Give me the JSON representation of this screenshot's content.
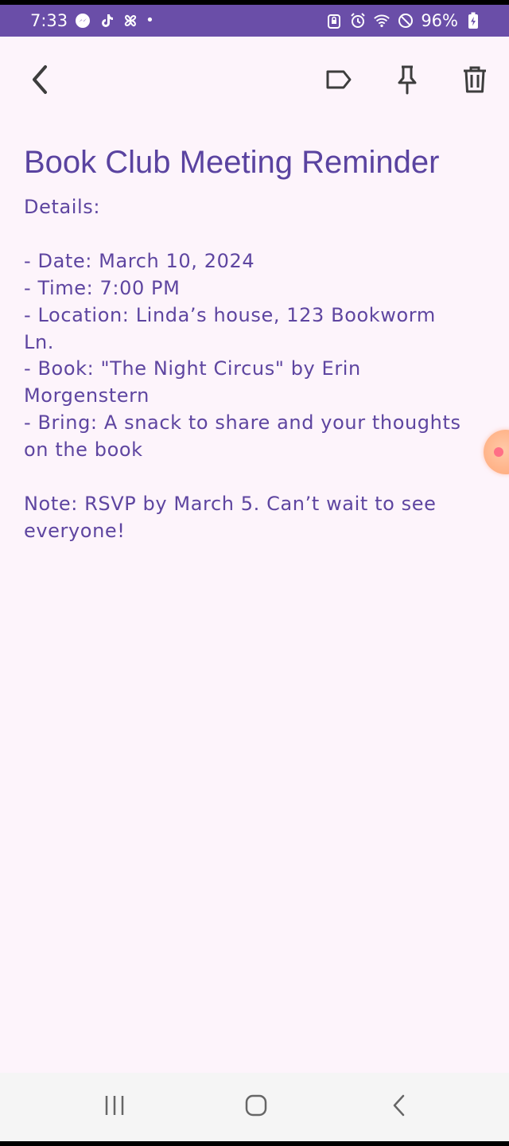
{
  "status_bar": {
    "time": "7:33",
    "battery": "96%",
    "notification_icons": [
      "messenger-icon",
      "tiktok-icon",
      "pinwheel-icon"
    ],
    "system_icons": [
      "app-lock-icon",
      "alarm-icon",
      "wifi-icon",
      "do-not-disturb-icon",
      "battery-charging-icon"
    ],
    "color": "#6a4ea8"
  },
  "toolbar": {
    "back_icon": "chevron-left-icon",
    "actions": [
      "label-icon",
      "pin-icon",
      "trash-icon"
    ]
  },
  "note": {
    "title": "Book Club Meeting Reminder",
    "body_lines": [
      "Details:",
      "",
      "- Date: March 10, 2024",
      "- Time: 7:00 PM",
      "- Location: Linda’s house, 123 Bookworm",
      "Ln.",
      "- Book: \"The Night Circus\" by Erin",
      "Morgenstern",
      "- Bring: A snack to share and your thoughts",
      "on the book",
      "",
      "Note: RSVP by March 5. Can’t wait to see",
      "everyone!"
    ],
    "text_color": "#5e45a0",
    "background": "#fdf4fb"
  },
  "nav_bar": {
    "buttons": [
      "recents-icon",
      "home-icon",
      "back-icon"
    ]
  }
}
